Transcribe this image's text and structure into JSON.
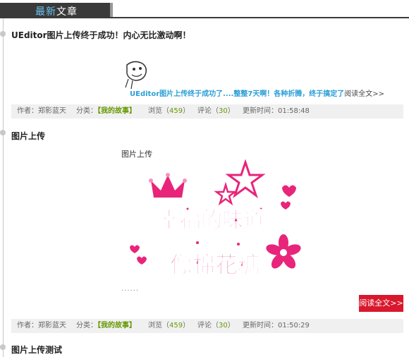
{
  "header": {
    "title_highlight": "最新",
    "title_rest": "文章"
  },
  "posts": [
    {
      "title": "UEditor图片上传终于成功！内心无比激动啊！",
      "excerpt": "UEditor图片上传终于成功了....整整7天啊！各种折腾，终于搞定了",
      "read_more": "阅读全文>>",
      "meta": {
        "author": "作者：郑影蓝天",
        "category_label": "分类：",
        "category": "【我的故事】",
        "views_label": "浏览（",
        "views": "459",
        "views_end": "）",
        "comments_label": "评论（",
        "comments": "30",
        "comments_end": "）",
        "updated": "更新时间：01:58:48"
      }
    },
    {
      "title": "图片上传",
      "body_text": "图片上传",
      "image_line1": "幸福的味道",
      "image_line2": "像棉花糖",
      "ellipsis": "......",
      "read_more": "阅读全文>>",
      "meta": {
        "author": "作者：郑影蓝天",
        "category_label": "分类：",
        "category": "【我的故事】",
        "views_label": "浏览（",
        "views": "459",
        "views_end": "）",
        "comments_label": "评论（",
        "comments": "30",
        "comments_end": "）",
        "updated": "更新时间：01:50:29"
      }
    },
    {
      "title": "图片上传测试"
    }
  ],
  "colors": {
    "accent_blue": "#2a9fd6",
    "category_green": "#669900",
    "button_red": "#d9182d",
    "image_pink": "#e8257a"
  }
}
